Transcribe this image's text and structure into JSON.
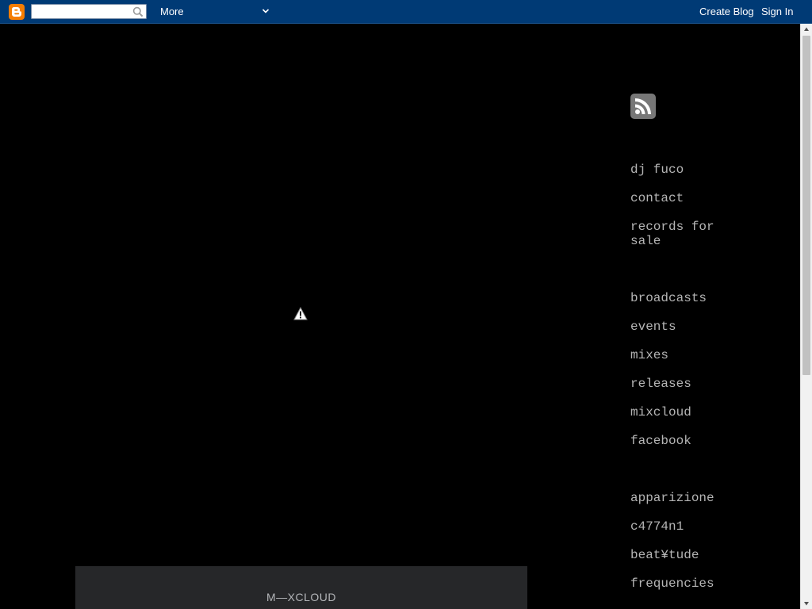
{
  "navbar": {
    "search": {
      "value": "",
      "placeholder": ""
    },
    "more_label": "More",
    "create_blog": "Create Blog",
    "sign_in": "Sign In",
    "background": "#003a75",
    "logo_color": "#f57d00"
  },
  "main": {
    "broken_embed_icon": "warning-icon",
    "widget": {
      "logo_text": "M—XCLOUD",
      "background": "#262729"
    }
  },
  "sidebar": {
    "feed_icon": "rss-icon",
    "pages": [
      "dj fuco",
      "contact",
      "records for sale"
    ],
    "sections": [
      "broadcasts",
      "events",
      "mixes",
      "releases",
      "mixcloud",
      "facebook"
    ],
    "labels": [
      "apparizione",
      "c4774n1",
      "beat¥tude",
      "frequencies"
    ],
    "link_color": "#b5b5b5"
  }
}
